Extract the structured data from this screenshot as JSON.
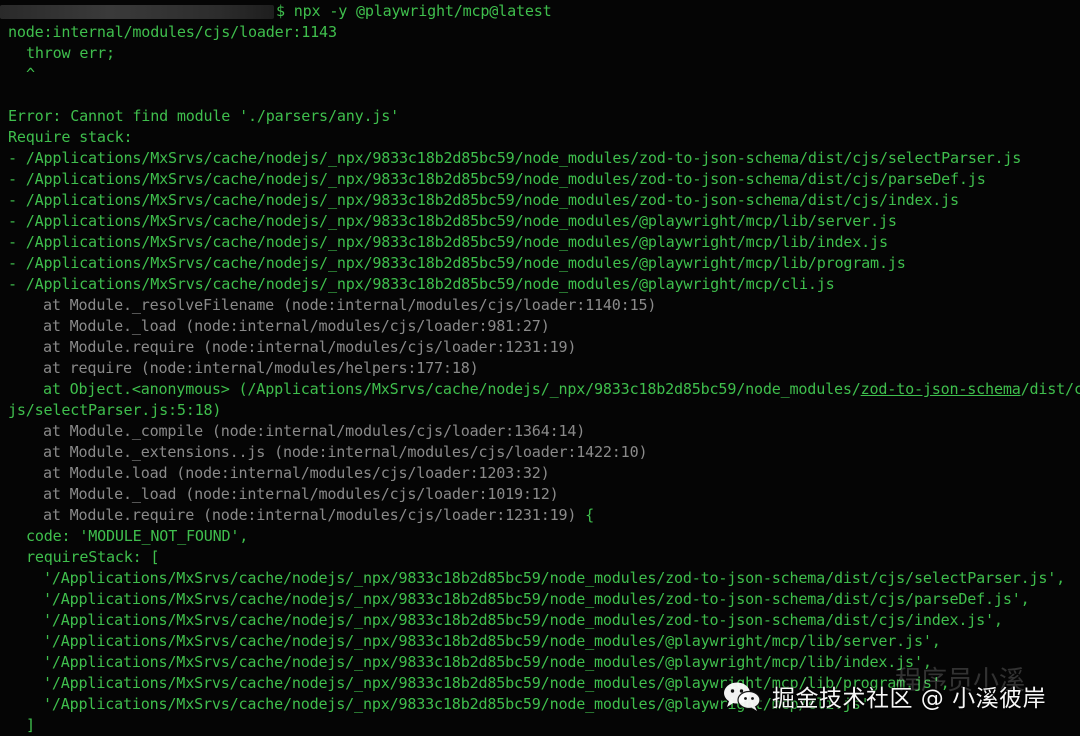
{
  "terminal": {
    "prompt_command": "$ npx -y @playwright/mcp@latest",
    "error_header": "node:internal/modules/cjs/loader:1143",
    "throw_line": "throw err;",
    "caret": "^",
    "error_message": "Error: Cannot find module './parsers/any.js'",
    "require_stack_label": "Require stack:",
    "require_stack": [
      "- /Applications/MxSrvs/cache/nodejs/_npx/9833c18b2d85bc59/node_modules/zod-to-json-schema/dist/cjs/selectParser.js",
      "- /Applications/MxSrvs/cache/nodejs/_npx/9833c18b2d85bc59/node_modules/zod-to-json-schema/dist/cjs/parseDef.js",
      "- /Applications/MxSrvs/cache/nodejs/_npx/9833c18b2d85bc59/node_modules/zod-to-json-schema/dist/cjs/index.js",
      "- /Applications/MxSrvs/cache/nodejs/_npx/9833c18b2d85bc59/node_modules/@playwright/mcp/lib/server.js",
      "- /Applications/MxSrvs/cache/nodejs/_npx/9833c18b2d85bc59/node_modules/@playwright/mcp/lib/index.js",
      "- /Applications/MxSrvs/cache/nodejs/_npx/9833c18b2d85bc59/node_modules/@playwright/mcp/lib/program.js",
      "- /Applications/MxSrvs/cache/nodejs/_npx/9833c18b2d85bc59/node_modules/@playwright/mcp/cli.js"
    ],
    "trace_top": [
      {
        "fn": "at Module._resolveFilename",
        "loc": " (node:internal/modules/cjs/loader:1140:15)"
      },
      {
        "fn": "at Module._load",
        "loc": " (node:internal/modules/cjs/loader:981:27)"
      },
      {
        "fn": "at Module.require",
        "loc": " (node:internal/modules/cjs/loader:1231:19)"
      },
      {
        "fn": "at require",
        "loc": " (node:internal/modules/helpers:177:18)"
      }
    ],
    "trace_object": {
      "fn": "at Object.<anonymous>",
      "pre": " (/Applications/MxSrvs/cache/nodejs/_npx/9833c18b2d85bc59/node_modules/",
      "link": "zod-to-json-schema",
      "post": "/dist/c",
      "wrap": "js/selectParser.js:5:18)"
    },
    "trace_bottom": [
      {
        "fn": "at Module._compile",
        "loc": " (node:internal/modules/cjs/loader:1364:14)",
        "tail": ""
      },
      {
        "fn": "at Module._extensions..js",
        "loc": " (node:internal/modules/cjs/loader:1422:10)",
        "tail": ""
      },
      {
        "fn": "at Module.load",
        "loc": " (node:internal/modules/cjs/loader:1203:32)",
        "tail": ""
      },
      {
        "fn": "at Module._load",
        "loc": " (node:internal/modules/cjs/loader:1019:12)",
        "tail": ""
      },
      {
        "fn": "at Module.require",
        "loc": " (node:internal/modules/cjs/loader:1231:19)",
        "tail": " {"
      }
    ],
    "code_line": "code: 'MODULE_NOT_FOUND',",
    "require_stack_open": "requireStack: [",
    "require_stack_entries": [
      "'/Applications/MxSrvs/cache/nodejs/_npx/9833c18b2d85bc59/node_modules/zod-to-json-schema/dist/cjs/selectParser.js',",
      "'/Applications/MxSrvs/cache/nodejs/_npx/9833c18b2d85bc59/node_modules/zod-to-json-schema/dist/cjs/parseDef.js',",
      "'/Applications/MxSrvs/cache/nodejs/_npx/9833c18b2d85bc59/node_modules/zod-to-json-schema/dist/cjs/index.js',",
      "'/Applications/MxSrvs/cache/nodejs/_npx/9833c18b2d85bc59/node_modules/@playwright/mcp/lib/server.js',",
      "'/Applications/MxSrvs/cache/nodejs/_npx/9833c18b2d85bc59/node_modules/@playwright/mcp/lib/index.js',",
      "'/Applications/MxSrvs/cache/nodejs/_npx/9833c18b2d85bc59/node_modules/@playwright/mcp/lib/program.js',",
      "'/Applications/MxSrvs/cache/nodejs/_npx/9833c18b2d85bc59/node_modules/@playwright/mcp/cli.js'"
    ],
    "require_stack_close": "]"
  },
  "watermark": {
    "text": "掘金技术社区 @ 小溪彼岸",
    "faint_text": "程序员小溪",
    "icon": "wechat-icon"
  },
  "colors": {
    "background": "#050505",
    "green": "#3fbf4d",
    "gray": "#8a8a8a",
    "watermark": "#ffffff"
  }
}
